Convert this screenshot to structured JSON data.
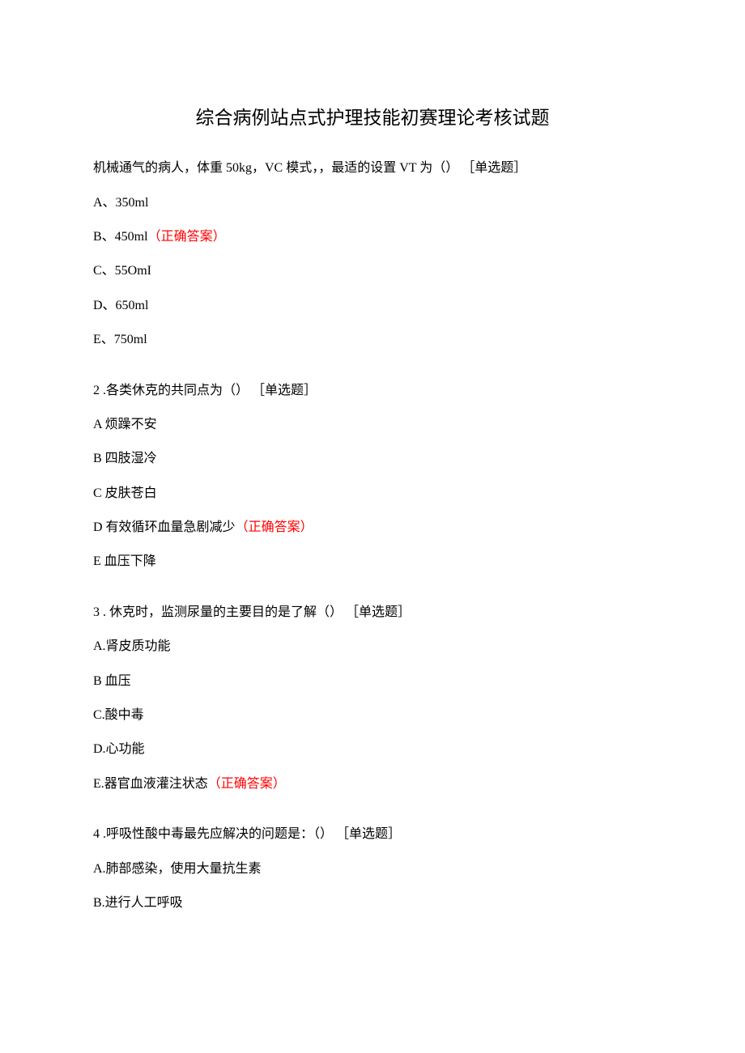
{
  "title": "综合病例站点式护理技能初赛理论考核试题",
  "correct_label": "（正确答案）",
  "questions": [
    {
      "text": "机械通气的病人，体重 50kg，VC 模式，，最适的设置 VT 为（） ［单选题］",
      "options": [
        {
          "text": "A、350ml",
          "correct": false
        },
        {
          "text": "B、450ml",
          "correct": true
        },
        {
          "text": "C、55OmI",
          "correct": false
        },
        {
          "text": "D、650ml",
          "correct": false
        },
        {
          "text": "E、750ml",
          "correct": false
        }
      ]
    },
    {
      "text": "2  .各类休克的共同点为（） ［单选题］",
      "options": [
        {
          "text": "A 烦躁不安",
          "correct": false
        },
        {
          "text": "B 四肢湿冷",
          "correct": false
        },
        {
          "text": "C 皮肤苍白",
          "correct": false
        },
        {
          "text": "D 有效循环血量急剧减少",
          "correct": true
        },
        {
          "text": "E 血压下降",
          "correct": false
        }
      ]
    },
    {
      "text": "3  .  休克时，监测尿量的主要目的是了解（） ［单选题］",
      "options": [
        {
          "text": "A.肾皮质功能",
          "correct": false
        },
        {
          "text": "B 血压",
          "correct": false
        },
        {
          "text": "C.酸中毒",
          "correct": false
        },
        {
          "text": "D.心功能",
          "correct": false
        },
        {
          "text": "E.器官血液灌注状态",
          "correct": true
        }
      ]
    },
    {
      "text": "4  .呼吸性酸中毒最先应解决的问题是：（） ［单选题］",
      "options": [
        {
          "text": "A.肺部感染，使用大量抗生素",
          "correct": false
        },
        {
          "text": "B.进行人工呼吸",
          "correct": false
        }
      ]
    }
  ]
}
